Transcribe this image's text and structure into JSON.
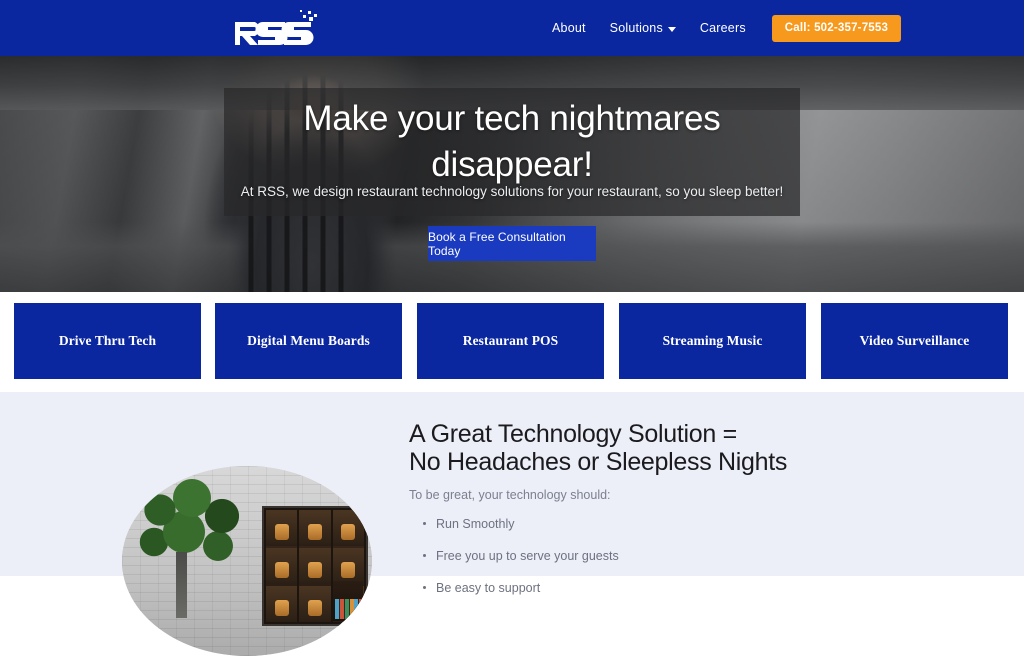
{
  "header": {
    "logo_text": "RSS",
    "logo_alt": "RSS logo",
    "nav": [
      {
        "label": "About",
        "has_caret": false
      },
      {
        "label": "Solutions",
        "has_caret": true
      },
      {
        "label": "Careers",
        "has_caret": false
      }
    ],
    "call_button": "Call: 502-357-7553",
    "bg_color": "#0a27a0",
    "call_button_color": "#f7991c"
  },
  "hero": {
    "title": "Make your tech nightmares disappear!",
    "subtitle": "At RSS, we design restaurant technology solutions for your restaurant, so you sleep better!",
    "cta_label": "Book a Free Consultation Today",
    "cta_color": "#1a3bbf"
  },
  "cards": [
    {
      "label": "Drive Thru Tech"
    },
    {
      "label": "Digital Menu Boards"
    },
    {
      "label": "Restaurant POS"
    },
    {
      "label": "Streaming Music"
    },
    {
      "label": "Video Surveillance"
    }
  ],
  "cards_color": "#0a27a0",
  "feature": {
    "image_alt": "Tree beside digital menu boards",
    "title_line1": "A Great Technology Solution =",
    "title_line2": "No Headaches or Sleepless Nights",
    "kicker": "To be great, your technology should:",
    "bullets": [
      "Run Smoothly",
      "Free you up to serve your guests",
      "Be easy to support"
    ],
    "bg_color": "#eceff7"
  }
}
